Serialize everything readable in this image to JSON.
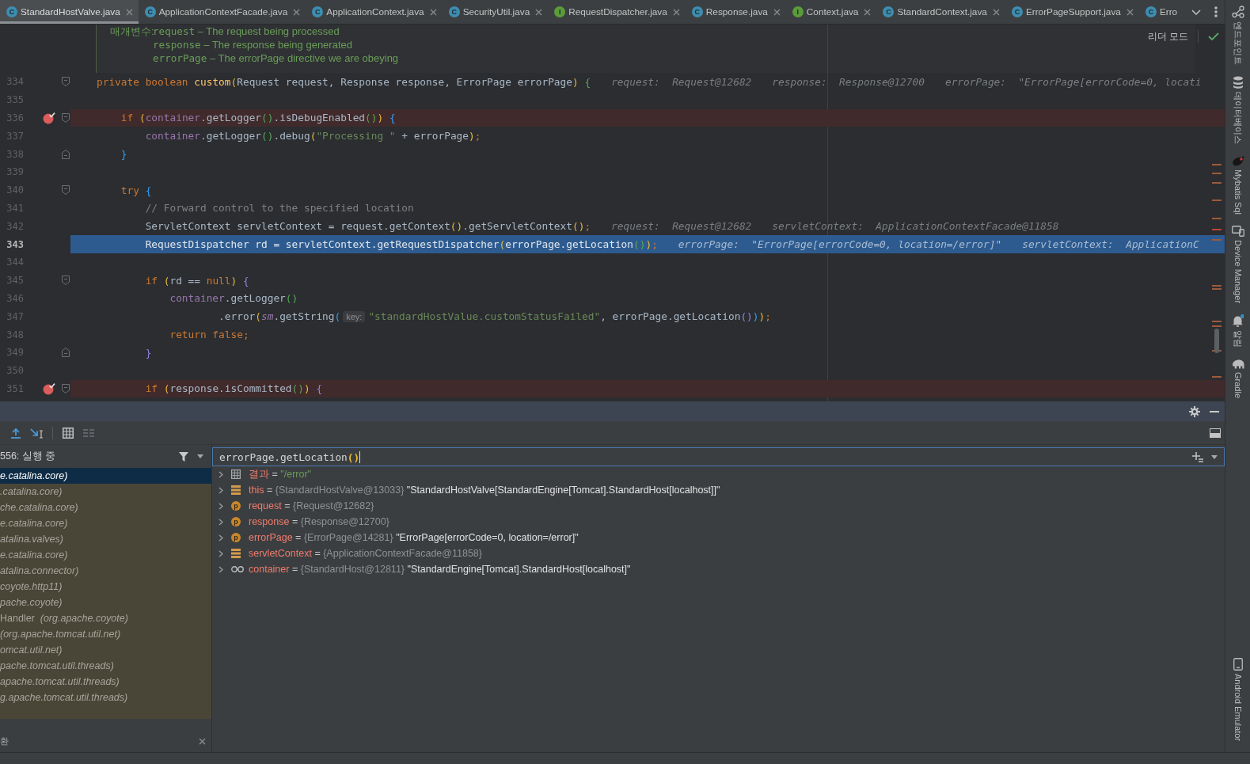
{
  "tabs": [
    {
      "label": "StandardHostValve.java",
      "kind": "class",
      "badge": "C",
      "selected": true,
      "closable": true
    },
    {
      "label": "ApplicationContextFacade.java",
      "kind": "class",
      "badge": "C",
      "selected": false,
      "closable": true
    },
    {
      "label": "ApplicationContext.java",
      "kind": "class",
      "badge": "C",
      "selected": false,
      "closable": true
    },
    {
      "label": "SecurityUtil.java",
      "kind": "class",
      "badge": "C",
      "selected": false,
      "closable": true
    },
    {
      "label": "RequestDispatcher.java",
      "kind": "interface",
      "badge": "I",
      "selected": false,
      "closable": true
    },
    {
      "label": "Response.java",
      "kind": "class",
      "badge": "C",
      "selected": false,
      "closable": true
    },
    {
      "label": "Context.java",
      "kind": "interface",
      "badge": "I",
      "selected": false,
      "closable": true
    },
    {
      "label": "StandardContext.java",
      "kind": "class",
      "badge": "C",
      "selected": false,
      "closable": true
    },
    {
      "label": "ErrorPageSupport.java",
      "kind": "class",
      "badge": "C",
      "selected": false,
      "closable": true
    },
    {
      "label": "Erro",
      "kind": "class",
      "badge": "C",
      "selected": false,
      "closable": false
    }
  ],
  "editor": {
    "reader_mode": {
      "label": "리더 모드"
    },
    "doc": {
      "label": "매개변수:",
      "params": [
        {
          "name": "request",
          "text": "– The request being processed"
        },
        {
          "name": "response",
          "text": "– The response being generated"
        },
        {
          "name": "errorPage",
          "text": "– The errorPage directive we are obeying"
        }
      ]
    },
    "lines": [
      {
        "number": "334",
        "kind": "block_start",
        "breakpoint": false,
        "current": false,
        "tokens": [
          {
            "text": "private boolean ",
            "kind": "keyword"
          },
          {
            "text": "custom",
            "kind": "method"
          },
          {
            "text": "(",
            "kind": "paren1"
          },
          {
            "text": "Request request, Response response, ErrorPage errorPage",
            "kind": "plain"
          },
          {
            "text": ")",
            "kind": "paren1"
          },
          {
            "text": " {",
            "kind": "paren2"
          }
        ],
        "values": [
          "request:  Request@12682",
          "response:  Response@12700",
          "errorPage:  \"ErrorPage[errorCode=0, locati"
        ],
        "children": [
          {
            "number": "335",
            "breakpoint": false,
            "current": false
          },
          {
            "number": "336",
            "kind": "block_start",
            "breakpoint": true,
            "current": false,
            "tokens": [
              {
                "text": "if ",
                "kind": "keyword"
              },
              {
                "text": "(",
                "kind": "paren1"
              },
              {
                "text": "container",
                "kind": "field"
              },
              {
                "text": ".getLogger",
                "kind": "plain"
              },
              {
                "text": "()",
                "kind": "paren2"
              },
              {
                "text": ".isDebugEnabled",
                "kind": "plain"
              },
              {
                "text": "()",
                "kind": "paren2"
              },
              {
                "text": ")",
                "kind": "paren1"
              },
              {
                "text": " {",
                "kind": "paren3"
              }
            ],
            "children": [
              {
                "number": "337",
                "kind": "statement",
                "breakpoint": false,
                "current": false,
                "tokens": [
                  {
                    "text": "container",
                    "kind": "field"
                  },
                  {
                    "text": ".getLogger",
                    "kind": "plain"
                  },
                  {
                    "text": "()",
                    "kind": "paren2"
                  },
                  {
                    "text": ".debug",
                    "kind": "plain"
                  },
                  {
                    "text": "(",
                    "kind": "paren1"
                  },
                  {
                    "text": "\"Processing \"",
                    "kind": "string"
                  },
                  {
                    "text": " + errorPage",
                    "kind": "plain"
                  },
                  {
                    "text": ")",
                    "kind": "paren1"
                  },
                  {
                    "text": ";",
                    "kind": "keyword"
                  }
                ]
              }
            ]
          },
          {
            "number": "338",
            "kind": "block_end",
            "breakpoint": false,
            "current": false,
            "tokens": [
              {
                "text": "}",
                "kind": "paren3"
              }
            ]
          },
          {
            "number": "339",
            "breakpoint": false,
            "current": false
          },
          {
            "number": "340",
            "kind": "block_start",
            "breakpoint": false,
            "current": false,
            "tokens": [
              {
                "text": "try ",
                "kind": "keyword"
              },
              {
                "text": "{",
                "kind": "paren3"
              }
            ],
            "children": [
              {
                "number": "341",
                "kind": "statement",
                "breakpoint": false,
                "current": false,
                "tokens": [
                  {
                    "text": "// Forward control to the specified location",
                    "kind": "comment"
                  }
                ]
              },
              {
                "number": "342",
                "kind": "statement",
                "breakpoint": false,
                "current": false,
                "tokens": [
                  {
                    "text": "ServletContext servletContext = request.getContext",
                    "kind": "plain"
                  },
                  {
                    "text": "()",
                    "kind": "paren1"
                  },
                  {
                    "text": ".getServletContext",
                    "kind": "plain"
                  },
                  {
                    "text": "()",
                    "kind": "paren1"
                  },
                  {
                    "text": ";",
                    "kind": "keyword"
                  }
                ],
                "values": [
                  "request:  Request@12682",
                  "servletContext:  ApplicationContextFacade@11858"
                ]
              },
              {
                "number": "343",
                "kind": "statement",
                "breakpoint": false,
                "current": true,
                "tokens": [
                  {
                    "text": "RequestDispatcher rd = servletContext.getRequestDispatcher",
                    "kind": "plain"
                  },
                  {
                    "text": "(",
                    "kind": "paren1"
                  },
                  {
                    "text": "errorPage.getLocation",
                    "kind": "plain"
                  },
                  {
                    "text": "()",
                    "kind": "paren2"
                  },
                  {
                    "text": ")",
                    "kind": "paren1"
                  },
                  {
                    "text": ";",
                    "kind": "keyword"
                  }
                ],
                "values": [
                  "errorPage:  \"ErrorPage[errorCode=0, location=/error]\"",
                  "servletContext:  ApplicationC"
                ]
              },
              {
                "number": "344",
                "breakpoint": false,
                "current": false
              },
              {
                "number": "345",
                "kind": "block_start",
                "breakpoint": false,
                "current": false,
                "tokens": [
                  {
                    "text": "if ",
                    "kind": "keyword"
                  },
                  {
                    "text": "(",
                    "kind": "paren1"
                  },
                  {
                    "text": "rd == ",
                    "kind": "plain"
                  },
                  {
                    "text": "null",
                    "kind": "keyword"
                  },
                  {
                    "text": ")",
                    "kind": "paren1"
                  },
                  {
                    "text": " {",
                    "kind": "paren4"
                  }
                ],
                "children": [
                  {
                    "number": "346",
                    "kind": "statement",
                    "breakpoint": false,
                    "current": false,
                    "tokens": [
                      {
                        "text": "container",
                        "kind": "field"
                      },
                      {
                        "text": ".getLogger",
                        "kind": "plain"
                      },
                      {
                        "text": "()",
                        "kind": "paren2"
                      }
                    ],
                    "children": [
                      {
                        "number": "347",
                        "kind": "continuation",
                        "breakpoint": false,
                        "current": false,
                        "tokens": [
                          {
                            "text": ".error",
                            "kind": "plain"
                          },
                          {
                            "text": "(",
                            "kind": "paren1"
                          },
                          {
                            "text": "sm",
                            "kind": "static"
                          },
                          {
                            "text": ".getString",
                            "kind": "plain"
                          },
                          {
                            "text": "(",
                            "kind": "paren3"
                          },
                          {
                            "text": "key:",
                            "kind": "hint"
                          },
                          {
                            "text": "\"standardHostValue.customStatusFailed\"",
                            "kind": "string"
                          },
                          {
                            "text": ", errorPage.getLocation",
                            "kind": "plain"
                          },
                          {
                            "text": "()",
                            "kind": "paren4"
                          },
                          {
                            "text": ")",
                            "kind": "paren3"
                          },
                          {
                            "text": ")",
                            "kind": "paren1"
                          },
                          {
                            "text": ";",
                            "kind": "keyword"
                          }
                        ]
                      }
                    ]
                  },
                  {
                    "number": "348",
                    "kind": "statement",
                    "breakpoint": false,
                    "current": false,
                    "tokens": [
                      {
                        "text": "return false;",
                        "kind": "keyword"
                      }
                    ]
                  }
                ]
              },
              {
                "number": "349",
                "kind": "block_end",
                "breakpoint": false,
                "current": false,
                "tokens": [
                  {
                    "text": "}",
                    "kind": "paren4"
                  }
                ]
              },
              {
                "number": "350",
                "breakpoint": false,
                "current": false
              },
              {
                "number": "351",
                "kind": "block_start",
                "breakpoint": true,
                "current": false,
                "tokens": [
                  {
                    "text": "if ",
                    "kind": "keyword"
                  },
                  {
                    "text": "(",
                    "kind": "paren1"
                  },
                  {
                    "text": "response.isCommitted",
                    "kind": "plain"
                  },
                  {
                    "text": "()",
                    "kind": "paren2"
                  },
                  {
                    "text": ")",
                    "kind": "paren1"
                  },
                  {
                    "text": " {",
                    "kind": "paren4"
                  }
                ]
              }
            ]
          }
        ]
      }
    ]
  },
  "debugger": {
    "frames": {
      "title": "556: 실행 중",
      "items": [
        {
          "package": "e.catalina.core)",
          "selected": true
        },
        {
          "package": ".catalina.core)",
          "selected": false
        },
        {
          "package": "che.catalina.core)",
          "selected": false
        },
        {
          "package": "e.catalina.core)",
          "selected": false
        },
        {
          "package": "atalina.valves)",
          "selected": false
        },
        {
          "package": "e.catalina.core)",
          "selected": false
        },
        {
          "package": "atalina.connector)",
          "selected": false
        },
        {
          "package": "coyote.http11)",
          "selected": false
        },
        {
          "package": "pache.coyote)",
          "selected": false
        },
        {
          "class": "Handler",
          "package": "(org.apache.coyote)",
          "selected": false
        },
        {
          "package": "(org.apache.tomcat.util.net)",
          "selected": false
        },
        {
          "package": "omcat.util.net)",
          "selected": false
        },
        {
          "package": "pache.tomcat.util.threads)",
          "selected": false
        },
        {
          "package": "apache.tomcat.util.threads)",
          "selected": false
        },
        {
          "package": "g.apache.tomcat.util.threads)",
          "selected": false
        }
      ]
    },
    "expression": {
      "tokens": [
        {
          "text": "errorPage.getLocation",
          "kind": "plain"
        },
        {
          "text": "()",
          "kind": "paren1"
        }
      ]
    },
    "variables": [
      {
        "name": "결과",
        "kind": "result",
        "expanded": false,
        "separator": "=",
        "value": "\"/error\""
      },
      {
        "name": "this",
        "kind": "field",
        "expanded": false,
        "separator": "=",
        "ref": "{StandardHostValve@13033}",
        "value": "\"StandardHostValve[StandardEngine[Tomcat].StandardHost[localhost]]\""
      },
      {
        "name": "request",
        "kind": "parameter",
        "badge": "p",
        "expanded": false,
        "separator": "=",
        "ref": "{Request@12682}"
      },
      {
        "name": "response",
        "kind": "parameter",
        "badge": "p",
        "expanded": false,
        "separator": "=",
        "ref": "{Response@12700}"
      },
      {
        "name": "errorPage",
        "kind": "parameter",
        "badge": "p",
        "expanded": false,
        "separator": "=",
        "ref": "{ErrorPage@14281}",
        "value": "\"ErrorPage[errorCode=0, location=/error]\""
      },
      {
        "name": "servletContext",
        "kind": "field",
        "expanded": false,
        "separator": "=",
        "ref": "{ApplicationContextFacade@11858}"
      },
      {
        "name": "container",
        "kind": "watch",
        "expanded": false,
        "separator": "=",
        "ref": "{StandardHost@12811}",
        "value": "\"StandardEngine[Tomcat].StandardHost[localhost]\""
      }
    ],
    "footer": {
      "label": "환"
    }
  },
  "tool_strip": {
    "top": [
      {
        "label": "엔드포인트",
        "kind": "endpoints"
      },
      {
        "label": "데이터베이스",
        "kind": "database"
      },
      {
        "label": "Mybatis Sql",
        "kind": "mybatis"
      },
      {
        "label": "Device Manager",
        "kind": "device"
      },
      {
        "label": "알림",
        "kind": "notifications"
      },
      {
        "label": "Gradle",
        "kind": "gradle"
      }
    ],
    "bottom": [
      {
        "label": "Android Emulator",
        "kind": "emulator"
      }
    ]
  }
}
